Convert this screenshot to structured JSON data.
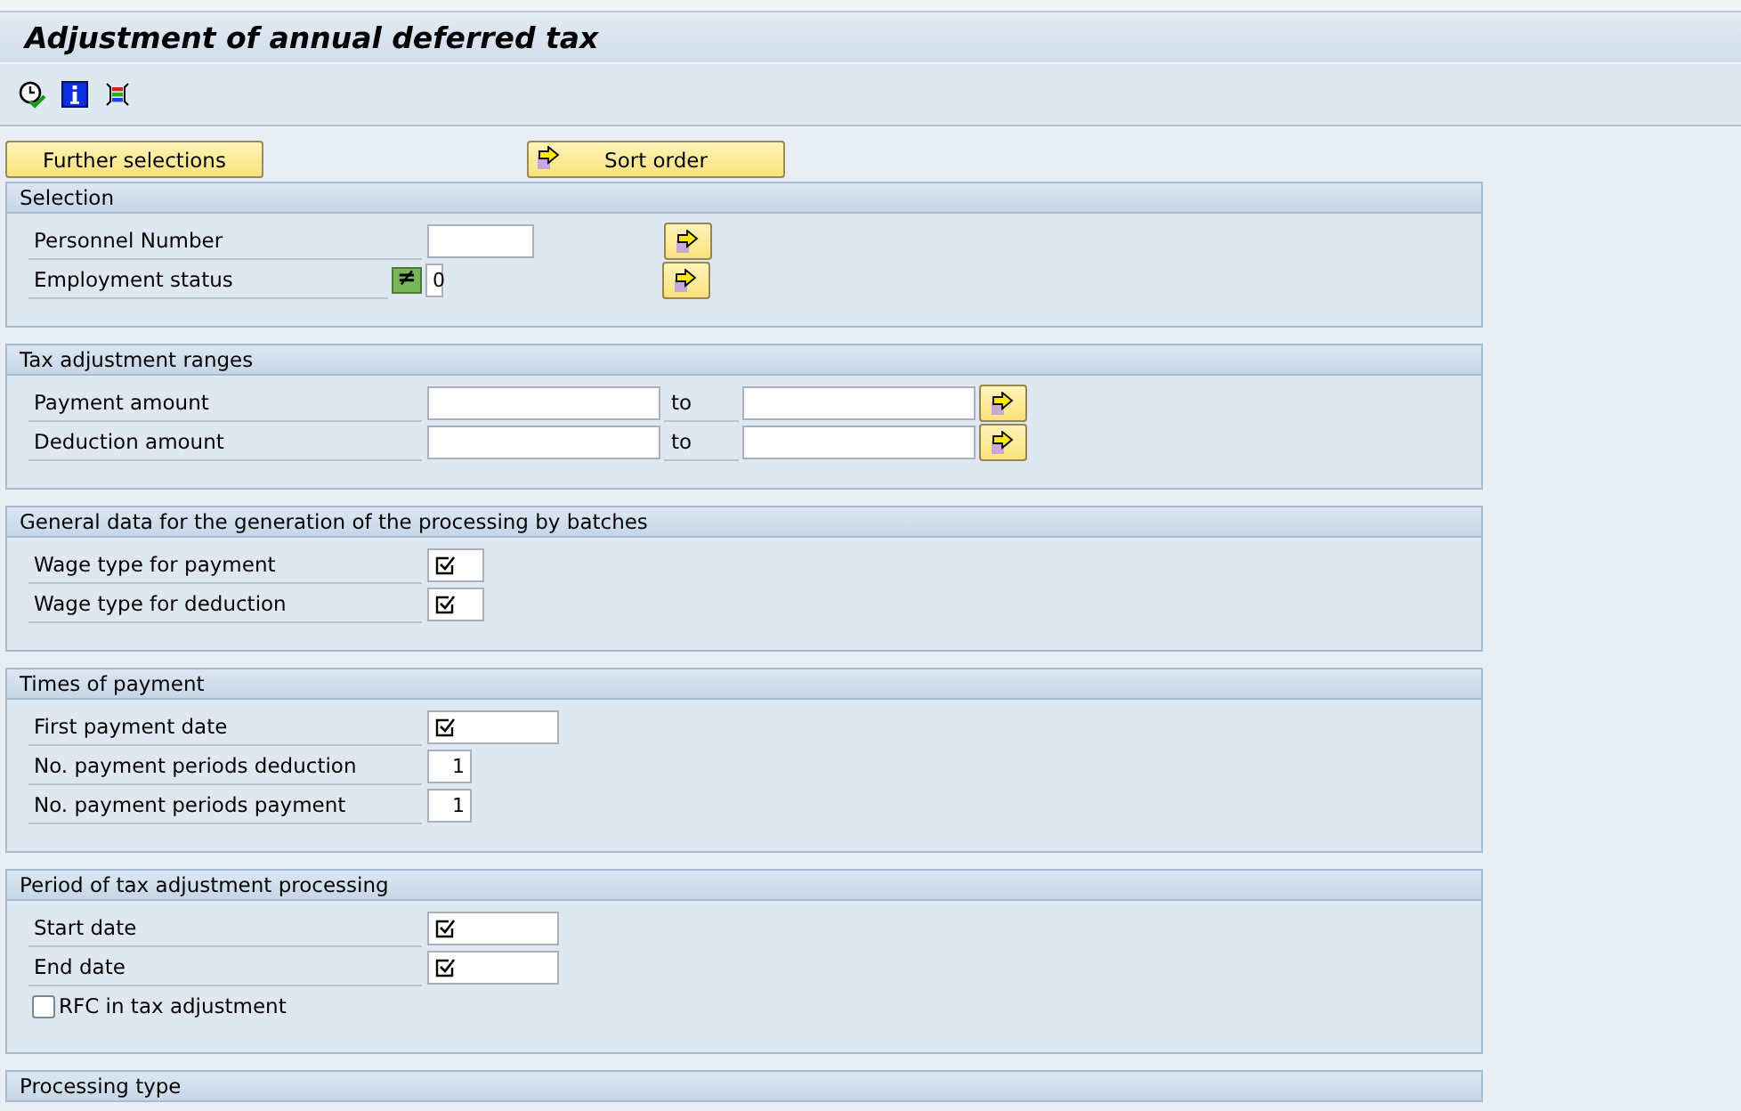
{
  "window": {
    "title": "Adjustment of annual deferred tax"
  },
  "buttons": [
    {
      "label": "Further selections",
      "arrow": false
    },
    {
      "label": "Sort order",
      "arrow": true
    }
  ],
  "groups": [
    {
      "title": "Selection",
      "rows": [
        {
          "kind": "text",
          "label": "Personnel Number",
          "required": false,
          "multiple": true
        },
        {
          "kind": "option",
          "label": "Employment status",
          "option": "≠",
          "value": "0",
          "required": false,
          "multiple": true
        }
      ]
    },
    {
      "title": "Tax adjustment ranges",
      "rows": [
        {
          "kind": "range",
          "label": "Payment amount",
          "to": "to"
        },
        {
          "kind": "range",
          "label": "Deduction amount",
          "to": "to"
        }
      ]
    },
    {
      "title": "General data for the generation of the processing by batches",
      "rows": [
        {
          "kind": "flag",
          "label": "Wage type for payment",
          "required": true,
          "multiple": false
        },
        {
          "kind": "flag",
          "label": "Wage type for deduction",
          "required": true,
          "multiple": false
        }
      ]
    },
    {
      "title": "Times of payment",
      "rows": [
        {
          "kind": "date",
          "label": "First payment date",
          "required": true,
          "multiple": false
        },
        {
          "kind": "count",
          "label": "No. payment periods deduction",
          "required": false,
          "value": "1",
          "multiple": false
        },
        {
          "kind": "count",
          "label": "No. payment periods payment",
          "required": false,
          "value": "1",
          "multiple": false
        }
      ]
    },
    {
      "title": "Period of tax adjustment processing",
      "rows": [
        {
          "kind": "date",
          "label": "Start date",
          "required": true,
          "multiple": false
        },
        {
          "kind": "date",
          "label": "End date",
          "required": true,
          "multiple": false
        },
        {
          "kind": "checkbox",
          "label": "RFC in tax adjustment",
          "checked": false
        }
      ]
    },
    {
      "title": "Processing type"
    }
  ]
}
